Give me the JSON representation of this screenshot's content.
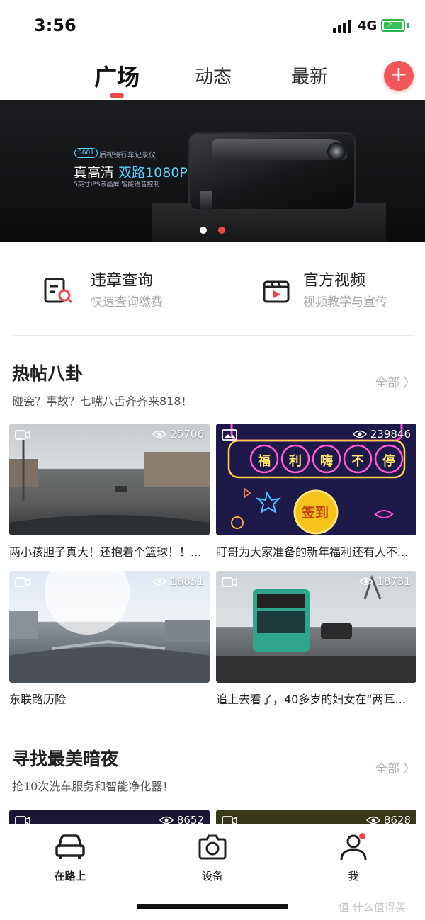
{
  "status_bar": {
    "time": "3:56",
    "network": "4G"
  },
  "top_tabs": [
    {
      "label": "广场",
      "active": true
    },
    {
      "label": "动态",
      "active": false
    },
    {
      "label": "最新",
      "active": false
    }
  ],
  "banner": {
    "badge": "S601",
    "subtitle": "后视镜行车记录仪",
    "title_plain": "真高清",
    "title_highlight": "双路1080P",
    "desc": "5英寸IPS液晶屏   智能语音控制",
    "page_count": 2,
    "active_page": 2
  },
  "quick_entries": [
    {
      "title": "违章查询",
      "subtitle": "快速查询缴费",
      "icon": "violation-search-icon"
    },
    {
      "title": "官方视频",
      "subtitle": "视频教学与宣传",
      "icon": "video-clapper-icon"
    }
  ],
  "sections": [
    {
      "title": "热帖八卦",
      "subtitle": "碰瓷？事故？七嘴八舌齐齐来818！",
      "more": "全部 〉",
      "cards": [
        {
          "type": "video",
          "views": "25706",
          "caption": "两小孩胆子真大！还抱着个篮球！！..."
        },
        {
          "type": "image",
          "views": "239846",
          "caption": "盯哥为大家准备的新年福利还有人不..."
        },
        {
          "type": "video",
          "views": "16851",
          "caption": "东联路历险"
        },
        {
          "type": "video",
          "views": "18731",
          "caption": "追上去看了，40多岁的妇女在“两耳..."
        }
      ]
    },
    {
      "title": "寻找最美暗夜",
      "subtitle": "抢10次洗车服务和智能净化器！",
      "more": "全部 〉",
      "cards": [
        {
          "type": "video",
          "views": "8652"
        },
        {
          "type": "video",
          "views": "8628"
        }
      ]
    }
  ],
  "neon_texts": [
    "福",
    "利",
    "嗨",
    "不",
    "停",
    "签到"
  ],
  "bottom_nav": [
    {
      "label": "在路上",
      "icon": "car-icon",
      "active": true
    },
    {
      "label": "设备",
      "icon": "camera-icon",
      "active": false
    },
    {
      "label": "我",
      "icon": "profile-icon",
      "active": false,
      "badge": true
    }
  ],
  "watermark": "值 什么值得买",
  "colors": {
    "accent": "#f0454b",
    "banner_highlight": "#5ad2ff",
    "muted": "#a8a8a8"
  }
}
